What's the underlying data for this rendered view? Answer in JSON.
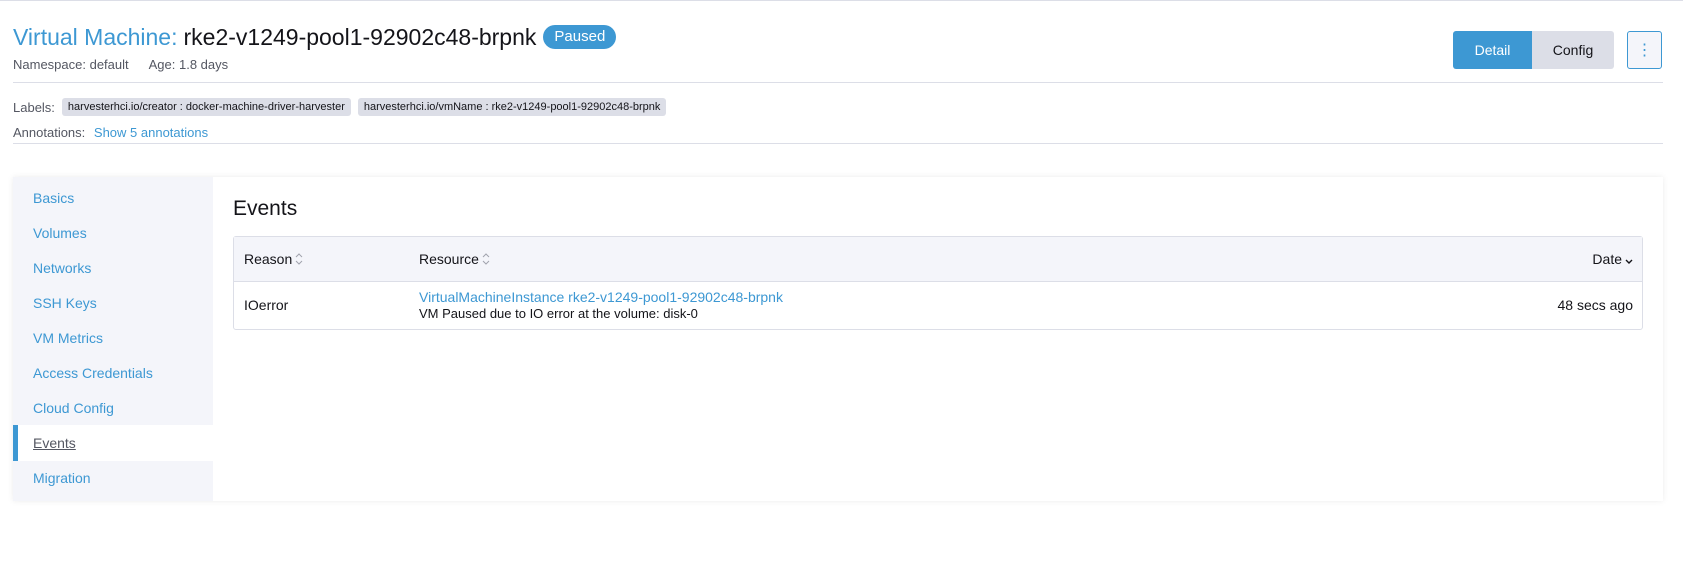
{
  "header": {
    "type_label": "Virtual Machine:",
    "name": "rke2-v1249-pool1-92902c48-brpnk",
    "status": "Paused",
    "namespace": "Namespace: default",
    "age": "Age: 1.8 days"
  },
  "actions": {
    "detail": "Detail",
    "config": "Config",
    "more": "⋮"
  },
  "labels": {
    "title": "Labels:",
    "items": [
      "harvesterhci.io/creator : docker-machine-driver-harvester",
      "harvesterhci.io/vmName : rke2-v1249-pool1-92902c48-brpnk"
    ]
  },
  "annotations": {
    "title": "Annotations:",
    "link": "Show 5 annotations"
  },
  "sidebar": {
    "items": [
      {
        "label": "Basics"
      },
      {
        "label": "Volumes"
      },
      {
        "label": "Networks"
      },
      {
        "label": "SSH Keys"
      },
      {
        "label": "VM Metrics"
      },
      {
        "label": "Access Credentials"
      },
      {
        "label": "Cloud Config"
      },
      {
        "label": "Events"
      },
      {
        "label": "Migration"
      }
    ],
    "active": "Events"
  },
  "events": {
    "title": "Events",
    "columns": [
      "Reason",
      "Resource",
      "Date"
    ],
    "rows": [
      {
        "reason": "IOerror",
        "resource": "VirtualMachineInstance rke2-v1249-pool1-92902c48-brpnk",
        "message": "VM Paused due to IO error at the volume: disk-0",
        "date": "48 secs ago"
      }
    ]
  },
  "colors": {
    "accent": "#3d98d3",
    "muted": "#545762",
    "border": "#dcdee7"
  }
}
